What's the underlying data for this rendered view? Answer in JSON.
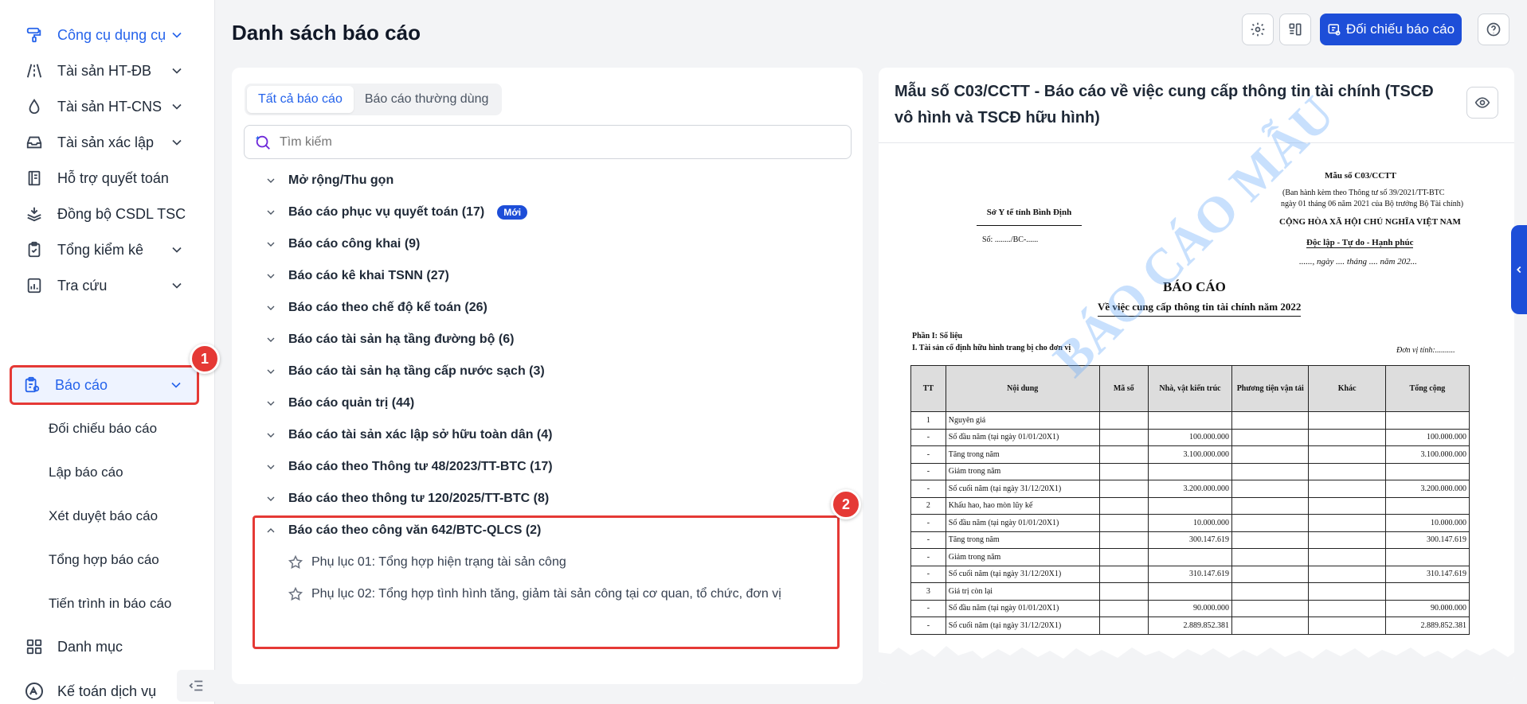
{
  "sidebar": {
    "items": [
      {
        "label": "Công cụ dụng cụ",
        "icon": "paint-roller-icon",
        "has_chevron": true
      },
      {
        "label": "Tài sản HT-ĐB",
        "icon": "road-icon",
        "has_chevron": true
      },
      {
        "label": "Tài sản HT-CNS",
        "icon": "water-drop-icon",
        "has_chevron": true
      },
      {
        "label": "Tài sản xác lập",
        "icon": "inbox-icon",
        "has_chevron": true
      },
      {
        "label": "Hỗ trợ quyết toán",
        "icon": "ledger-icon",
        "has_chevron": false
      },
      {
        "label": "Đồng bộ CSDL TSC",
        "icon": "layers-sync-icon",
        "has_chevron": false
      },
      {
        "label": "Tổng kiểm kê",
        "icon": "clipboard-check-icon",
        "has_chevron": true
      },
      {
        "label": "Tra cứu",
        "icon": "chart-doc-icon",
        "has_chevron": true
      },
      {
        "label": "Báo cáo",
        "icon": "report-clipboard-icon",
        "has_chevron": true
      },
      {
        "label": "Danh mục",
        "icon": "grid-icon",
        "has_chevron": false
      },
      {
        "label": "Kế toán dịch vụ",
        "icon": "accounting-icon",
        "has_chevron": false
      }
    ],
    "subitems": [
      "Đối chiếu báo cáo",
      "Lập báo cáo",
      "Xét duyệt báo cáo",
      "Tổng hợp báo cáo",
      "Tiến trình in báo cáo"
    ],
    "annotation_1": "1"
  },
  "header": {
    "title": "Danh sách báo cáo",
    "compare_button": "Đối chiếu báo cáo"
  },
  "left_panel": {
    "tabs": [
      "Tất cả báo cáo",
      "Báo cáo thường dùng"
    ],
    "search_placeholder": "Tìm kiếm",
    "tree": [
      {
        "label": "Mở rộng/Thu gọn",
        "badge": ""
      },
      {
        "label": "Báo cáo phục vụ quyết toán (17)",
        "badge": "Mới"
      },
      {
        "label": "Báo cáo công khai (9)",
        "badge": ""
      },
      {
        "label": "Báo cáo kê khai TSNN (27)",
        "badge": ""
      },
      {
        "label": "Báo cáo theo chế độ kế toán (26)",
        "badge": ""
      },
      {
        "label": "Báo cáo tài sản hạ tầng đường bộ (6)",
        "badge": ""
      },
      {
        "label": "Báo cáo tài sản hạ tầng cấp nước sạch (3)",
        "badge": ""
      },
      {
        "label": "Báo cáo quản trị (44)",
        "badge": ""
      },
      {
        "label": "Báo cáo tài sản xác lập sở hữu toàn dân (4)",
        "badge": ""
      },
      {
        "label": "Báo cáo theo Thông tư 48/2023/TT-BTC (17)",
        "badge": ""
      },
      {
        "label": "Báo cáo theo thông tư 120/2025/TT-BTC (8)",
        "badge": ""
      },
      {
        "label": "Báo cáo theo công văn 642/BTC-QLCS (2)",
        "badge": ""
      }
    ],
    "leaves": [
      "Phụ lục 01: Tổng hợp hiện trạng tài sản công",
      "Phụ lục 02: Tổng hợp tình hình tăng, giảm tài sản công tại cơ quan, tổ chức, đơn vị"
    ],
    "annotation_2": "2"
  },
  "preview": {
    "title": "Mẫu số C03/CCTT - Báo cáo về việc cung cấp thông tin tài chính (TSCĐ vô hình và TSCĐ hữu hình)",
    "doc": {
      "form_no": "Mẫu số C03/CCTT",
      "issued_1": "(Ban hành kèm theo Thông tư số 39/2021/TT-BTC",
      "issued_2": "ngày 01 tháng 06 năm 2021 của Bộ trưởng Bộ Tài chính)",
      "agency": "Sở Y tế tỉnh Bình Định",
      "number": "Số: ......../BC-......",
      "nation": "CỘNG HÒA XÃ HỘI CHỦ NGHĨA VIỆT NAM",
      "motto": "Độc lập - Tự do - Hạnh phúc",
      "date": "......, ngày .... tháng .... năm 202...",
      "heading": "BÁO CÁO",
      "subheading": "Về việc cung cấp thông tin tài chính năm 2022",
      "part": "Phần I: Số liệu",
      "section": "I. Tài sản cố định hữu hình trang bị cho đơn vị",
      "unit": "Đơn vị tính:..........",
      "watermark": "BÁO CÁO MẪU",
      "columns": [
        "TT",
        "Nội dung",
        "Mã số",
        "Nhà, vật kiến trúc",
        "Phương tiện vận tải",
        "Khác",
        "Tổng cộng"
      ],
      "rows": [
        [
          "1",
          "Nguyên giá",
          "",
          "",
          "",
          "",
          ""
        ],
        [
          "-",
          "Số đầu năm (tại ngày 01/01/20X1)",
          "",
          "100.000.000",
          "",
          "",
          "100.000.000"
        ],
        [
          "-",
          "Tăng trong năm",
          "",
          "3.100.000.000",
          "",
          "",
          "3.100.000.000"
        ],
        [
          "-",
          "Giảm trong năm",
          "",
          "",
          "",
          "",
          ""
        ],
        [
          "-",
          "Số cuối năm (tại ngày 31/12/20X1)",
          "",
          "3.200.000.000",
          "",
          "",
          "3.200.000.000"
        ],
        [
          "2",
          "Khấu hao, hao mòn lũy kế",
          "",
          "",
          "",
          "",
          ""
        ],
        [
          "-",
          "Số đầu năm (tại ngày 01/01/20X1)",
          "",
          "10.000.000",
          "",
          "",
          "10.000.000"
        ],
        [
          "-",
          "Tăng trong năm",
          "",
          "300.147.619",
          "",
          "",
          "300.147.619"
        ],
        [
          "-",
          "Giảm trong năm",
          "",
          "",
          "",
          "",
          ""
        ],
        [
          "-",
          "Số cuối năm (tại ngày 31/12/20X1)",
          "",
          "310.147.619",
          "",
          "",
          "310.147.619"
        ],
        [
          "3",
          "Giá trị còn lại",
          "",
          "",
          "",
          "",
          ""
        ],
        [
          "-",
          "Số đầu năm (tại ngày 01/01/20X1)",
          "",
          "90.000.000",
          "",
          "",
          "90.000.000"
        ],
        [
          "-",
          "Số cuối năm (tại ngày 31/12/20X1)",
          "",
          "2.889.852.381",
          "",
          "",
          "2.889.852.381"
        ]
      ]
    }
  },
  "colors": {
    "accent": "#2563eb",
    "primary_button": "#1d4ed8",
    "highlight": "#e53935"
  }
}
